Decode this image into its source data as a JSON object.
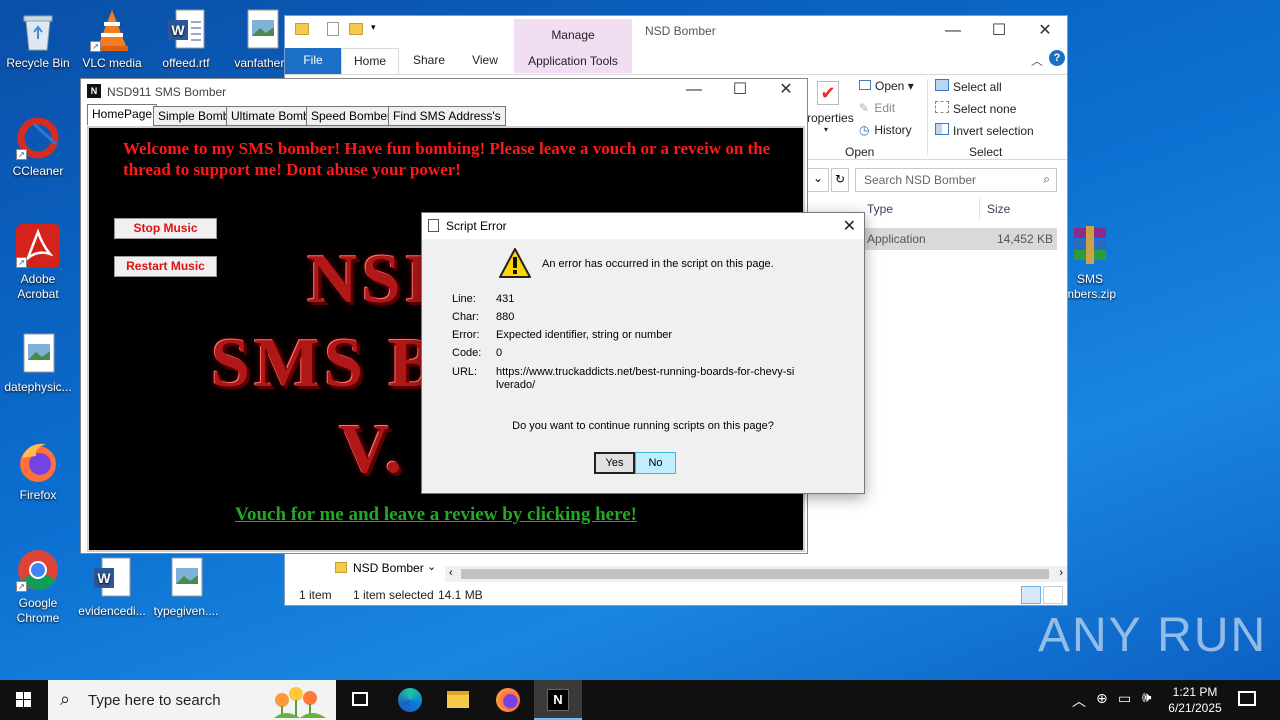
{
  "desktop": {
    "icons": [
      {
        "label": "Recycle Bin"
      },
      {
        "label": "VLC media"
      },
      {
        "label": "offeed.rtf"
      },
      {
        "label": "vanfather.j"
      },
      {
        "label": "CCleaner"
      },
      {
        "label": "Adobe Acrobat"
      },
      {
        "label": "datephysic..."
      },
      {
        "label": "Firefox"
      },
      {
        "label": "Google Chrome"
      },
      {
        "label": "evidencedi..."
      },
      {
        "label": "typegiven...."
      },
      {
        "label": "SMS mbers.zip"
      }
    ]
  },
  "explorer": {
    "title": "NSD Bomber",
    "manage_tab": "Manage",
    "app_tools_tab": "Application Tools",
    "tabs": [
      "File",
      "Home",
      "Share",
      "View"
    ],
    "ribbon": {
      "properties": "roperties",
      "open": "Open",
      "edit": "Edit",
      "history": "History",
      "open_group": "Open",
      "select_all": "Select all",
      "select_none": "Select none",
      "invert_selection": "Invert selection",
      "select_group": "Select"
    },
    "search_placeholder": "Search NSD Bomber",
    "columns": {
      "type": "Type",
      "size": "Size"
    },
    "file_row": {
      "type": "Application",
      "size": "14,452 KB"
    },
    "nav_folder": "NSD Bomber",
    "status": {
      "count": "1 item",
      "selected": "1 item selected",
      "size": "14.1 MB"
    }
  },
  "bomber": {
    "title": "NSD911 SMS Bomber",
    "tabs": [
      "HomePage",
      "Simple Bomb",
      "Ultimate Bomb",
      "Speed Bomber",
      "Find SMS Address's"
    ],
    "welcome": "Welcome to my SMS bomber! Have fun bombing! Please leave a vouch or a reveiw on the thread to support me! Dont abuse your power!",
    "stop_music": "Stop Music",
    "restart_music": "Restart Music",
    "big_line1": "NSI",
    "big_line2": "SMS B",
    "big_line3": "V.",
    "vouch_link": "Vouch for me and leave a review by clicking here!"
  },
  "dialog": {
    "title": "Script Error",
    "message": "An error has occurred in the script on this page.",
    "line_label": "Line:",
    "line_value": "431",
    "char_label": "Char:",
    "char_value": "880",
    "error_label": "Error:",
    "error_value": "Expected identifier, string or number",
    "code_label": "Code:",
    "code_value": "0",
    "url_label": "URL:",
    "url_value": "https://www.truckaddicts.net/best-running-boards-for-chevy-silverado/",
    "question": "Do you want to continue running scripts on this page?",
    "yes": "Yes",
    "no": "No"
  },
  "taskbar": {
    "search_placeholder": "Type here to search",
    "time": "1:21 PM",
    "date": "6/21/2025"
  },
  "watermark": "ANY RUN"
}
